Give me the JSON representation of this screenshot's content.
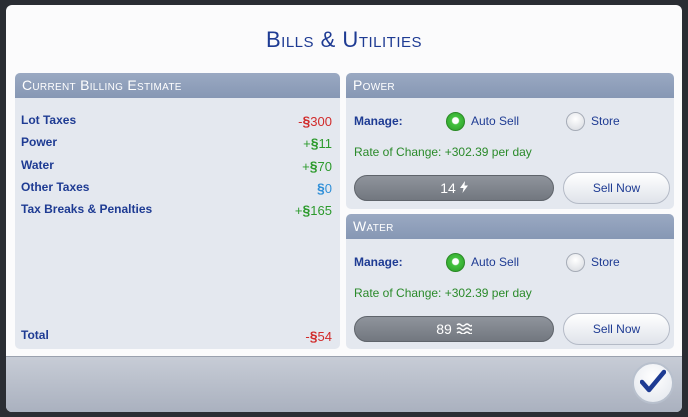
{
  "dialog": {
    "title": "Bills & Utilities"
  },
  "billing": {
    "header": "Current Billing Estimate",
    "rows": [
      {
        "label": "Lot Taxes",
        "sign": "-",
        "amount": "300"
      },
      {
        "label": "Power",
        "sign": "+",
        "amount": "11"
      },
      {
        "label": "Water",
        "sign": "+",
        "amount": "70"
      },
      {
        "label": "Other Taxes",
        "sign": "",
        "amount": "0"
      },
      {
        "label": "Tax Breaks & Penalties",
        "sign": "+",
        "amount": "165"
      }
    ],
    "total": {
      "label": "Total",
      "sign": "-",
      "amount": "54"
    },
    "currency_symbol": "§"
  },
  "power": {
    "header": "Power",
    "manage_label": "Manage:",
    "option_auto": "Auto Sell",
    "option_store": "Store",
    "selected": "Auto Sell",
    "rate": "Rate of Change: +302.39 per day",
    "meter_value": "14",
    "meter_icon": "lightning-bolt-icon",
    "sell_label": "Sell Now"
  },
  "water": {
    "header": "Water",
    "manage_label": "Manage:",
    "option_auto": "Auto Sell",
    "option_store": "Store",
    "selected": "Auto Sell",
    "rate": "Rate of Change: +302.39 per day",
    "meter_value": "89",
    "meter_icon": "water-waves-icon",
    "sell_label": "Sell Now"
  },
  "colors": {
    "title": "#1e3b93",
    "negative": "#d12b2b",
    "positive": "#2c9a2c",
    "zero": "#2f8fd8"
  }
}
